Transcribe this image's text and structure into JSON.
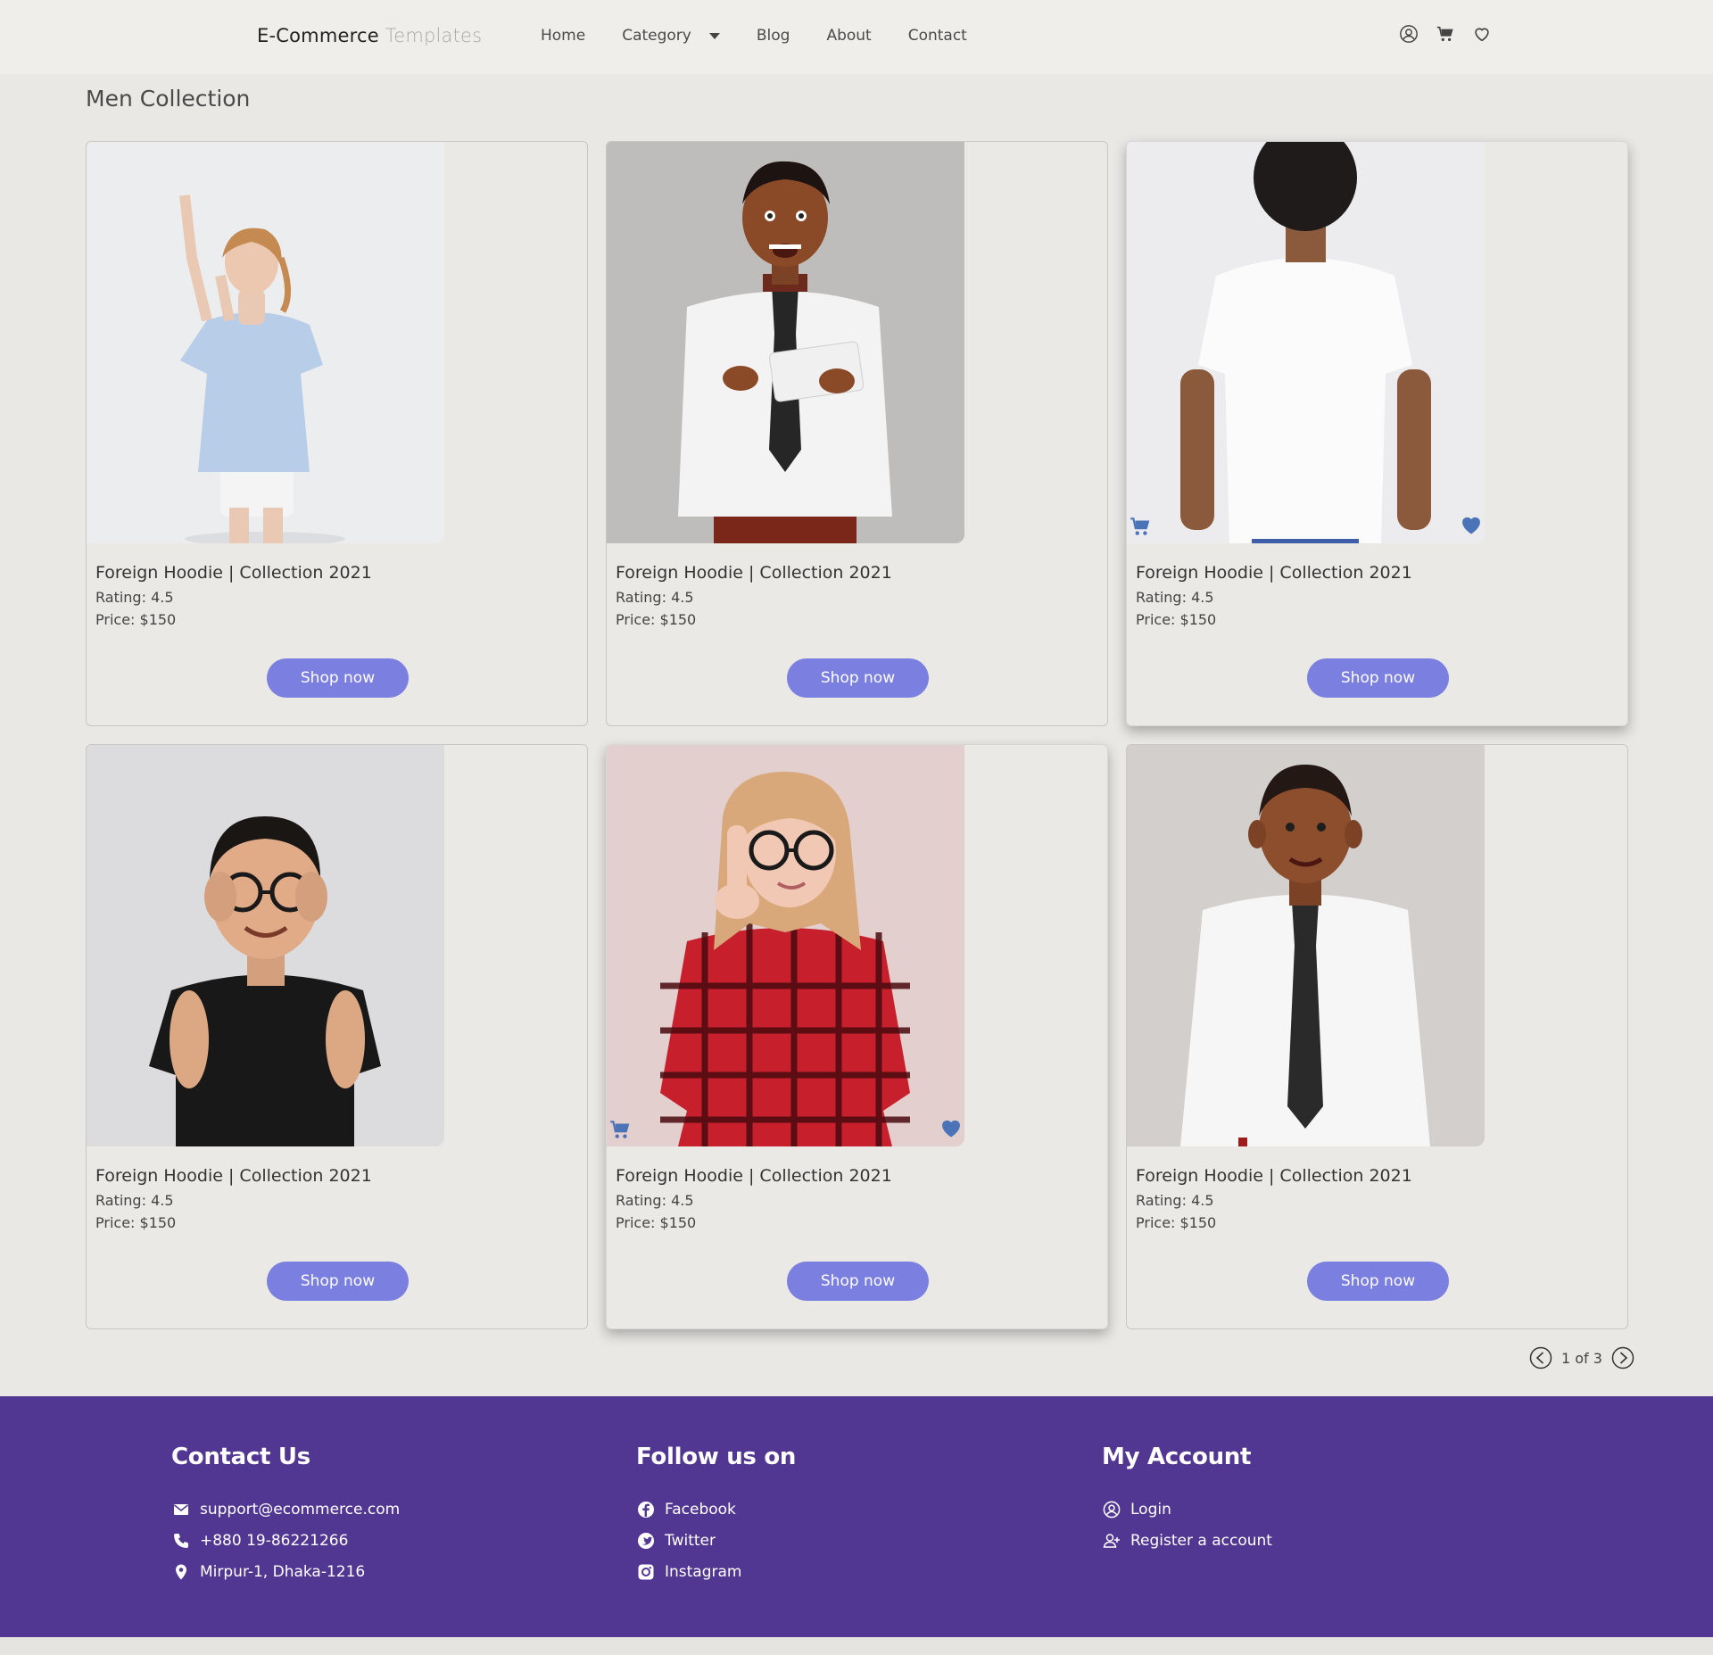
{
  "header": {
    "brand_primary": "E-Commerce",
    "brand_secondary": "Templates",
    "nav": [
      {
        "label": "Home"
      },
      {
        "label": "Category"
      },
      {
        "label": "Blog"
      },
      {
        "label": "About"
      },
      {
        "label": "Contact"
      }
    ],
    "icons": [
      "user-icon",
      "cart-icon",
      "heart-icon"
    ]
  },
  "section": {
    "title": "Men Collection"
  },
  "products": [
    {
      "title": "Foreign Hoodie | Collection 2021",
      "rating": "Rating: 4.5",
      "price": "Price: $150",
      "button": "Shop now",
      "image": "girl-light-blue-top"
    },
    {
      "title": "Foreign Hoodie | Collection 2021",
      "rating": "Rating: 4.5",
      "price": "Price: $150",
      "button": "Shop now",
      "image": "boy-shirt-tie-tablet"
    },
    {
      "title": "Foreign Hoodie | Collection 2021",
      "rating": "Rating: 4.5",
      "price": "Price: $150",
      "button": "Shop now",
      "image": "boy-white-tshirt-back"
    },
    {
      "title": "Foreign Hoodie | Collection 2021",
      "rating": "Rating: 4.5",
      "price": "Price: $150",
      "button": "Shop now",
      "image": "boy-black-tshirt-glasses"
    },
    {
      "title": "Foreign Hoodie | Collection 2021",
      "rating": "Rating: 4.5",
      "price": "Price: $150",
      "button": "Shop now",
      "image": "girl-red-plaid-glasses"
    },
    {
      "title": "Foreign Hoodie | Collection 2021",
      "rating": "Rating: 4.5",
      "price": "Price: $150",
      "button": "Shop now",
      "image": "boy-white-shirt-tie"
    }
  ],
  "pager": {
    "text": "1 of 3"
  },
  "footer": {
    "contact": {
      "heading": "Contact Us",
      "items": [
        {
          "icon": "mail-icon",
          "text": "support@ecommerce.com"
        },
        {
          "icon": "phone-icon",
          "text": "+880 19-86221266"
        },
        {
          "icon": "location-icon",
          "text": "Mirpur-1, Dhaka-1216"
        }
      ]
    },
    "follow": {
      "heading": "Follow us on",
      "items": [
        {
          "icon": "facebook-icon",
          "text": "Facebook"
        },
        {
          "icon": "twitter-icon",
          "text": "Twitter"
        },
        {
          "icon": "instagram-icon",
          "text": "Instagram"
        }
      ]
    },
    "account": {
      "heading": "My Account",
      "items": [
        {
          "icon": "user-icon",
          "text": "Login"
        },
        {
          "icon": "add-user-icon",
          "text": "Register a account"
        }
      ]
    }
  },
  "colors": {
    "accent": "#7b7fe0",
    "footer": "#513692",
    "overlay_icons": "#4a73b8"
  }
}
